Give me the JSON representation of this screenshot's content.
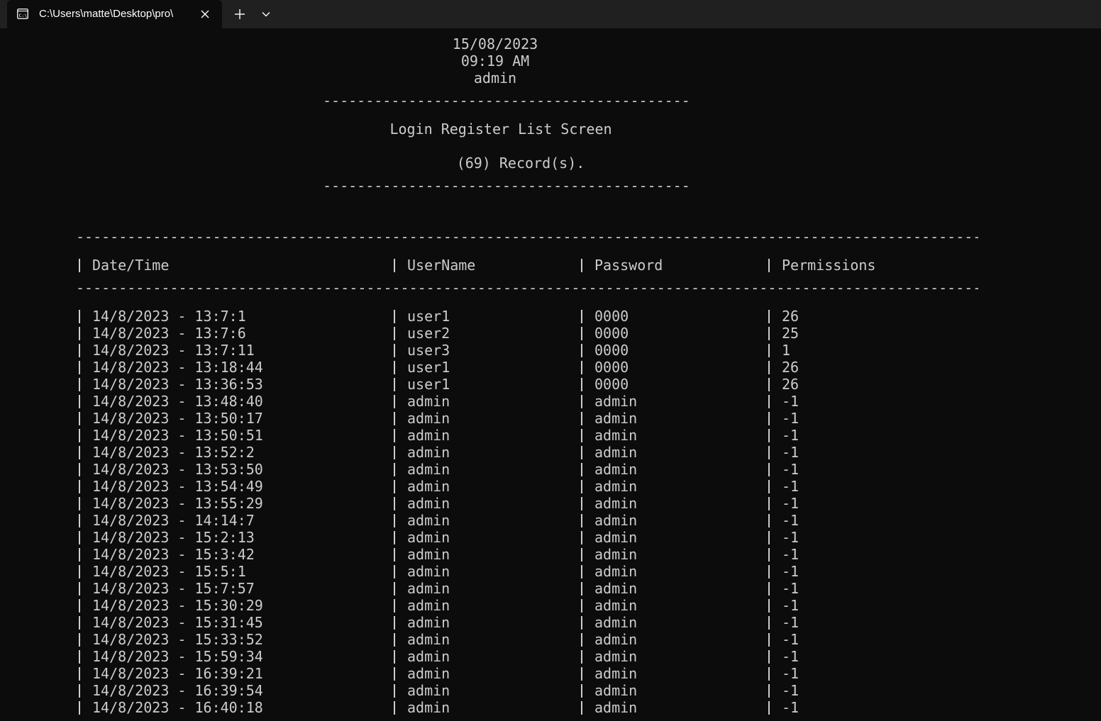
{
  "tab": {
    "title": "C:\\Users\\matte\\Desktop\\pro\\",
    "icon": "terminal-icon"
  },
  "toolbar": {
    "new_tab": "+",
    "dropdown": "chevron-down-icon"
  },
  "header": {
    "date": "15/08/2023",
    "time": "09:19 AM",
    "user": "admin",
    "separator": "-------------------------------------------",
    "screen_title": "Login Register List Screen",
    "record_count": "(69) Record(s)."
  },
  "table": {
    "separator": "-----------------------------------------------------------------------------------------------------------",
    "columns": [
      "Date/Time",
      "UserName",
      "Password",
      "Permissions"
    ],
    "rows": [
      [
        "14/8/2023 - 13:7:1",
        "user1",
        "0000",
        "26"
      ],
      [
        "14/8/2023 - 13:7:6",
        "user2",
        "0000",
        "25"
      ],
      [
        "14/8/2023 - 13:7:11",
        "user3",
        "0000",
        "1"
      ],
      [
        "14/8/2023 - 13:18:44",
        "user1",
        "0000",
        "26"
      ],
      [
        "14/8/2023 - 13:36:53",
        "user1",
        "0000",
        "26"
      ],
      [
        "14/8/2023 - 13:48:40",
        "admin",
        "admin",
        "-1"
      ],
      [
        "14/8/2023 - 13:50:17",
        "admin",
        "admin",
        "-1"
      ],
      [
        "14/8/2023 - 13:50:51",
        "admin",
        "admin",
        "-1"
      ],
      [
        "14/8/2023 - 13:52:2",
        "admin",
        "admin",
        "-1"
      ],
      [
        "14/8/2023 - 13:53:50",
        "admin",
        "admin",
        "-1"
      ],
      [
        "14/8/2023 - 13:54:49",
        "admin",
        "admin",
        "-1"
      ],
      [
        "14/8/2023 - 13:55:29",
        "admin",
        "admin",
        "-1"
      ],
      [
        "14/8/2023 - 14:14:7",
        "admin",
        "admin",
        "-1"
      ],
      [
        "14/8/2023 - 15:2:13",
        "admin",
        "admin",
        "-1"
      ],
      [
        "14/8/2023 - 15:3:42",
        "admin",
        "admin",
        "-1"
      ],
      [
        "14/8/2023 - 15:5:1",
        "admin",
        "admin",
        "-1"
      ],
      [
        "14/8/2023 - 15:7:57",
        "admin",
        "admin",
        "-1"
      ],
      [
        "14/8/2023 - 15:30:29",
        "admin",
        "admin",
        "-1"
      ],
      [
        "14/8/2023 - 15:31:45",
        "admin",
        "admin",
        "-1"
      ],
      [
        "14/8/2023 - 15:33:52",
        "admin",
        "admin",
        "-1"
      ],
      [
        "14/8/2023 - 15:59:34",
        "admin",
        "admin",
        "-1"
      ],
      [
        "14/8/2023 - 16:39:21",
        "admin",
        "admin",
        "-1"
      ],
      [
        "14/8/2023 - 16:39:54",
        "admin",
        "admin",
        "-1"
      ],
      [
        "14/8/2023 - 16:40:18",
        "admin",
        "admin",
        "-1"
      ]
    ]
  }
}
